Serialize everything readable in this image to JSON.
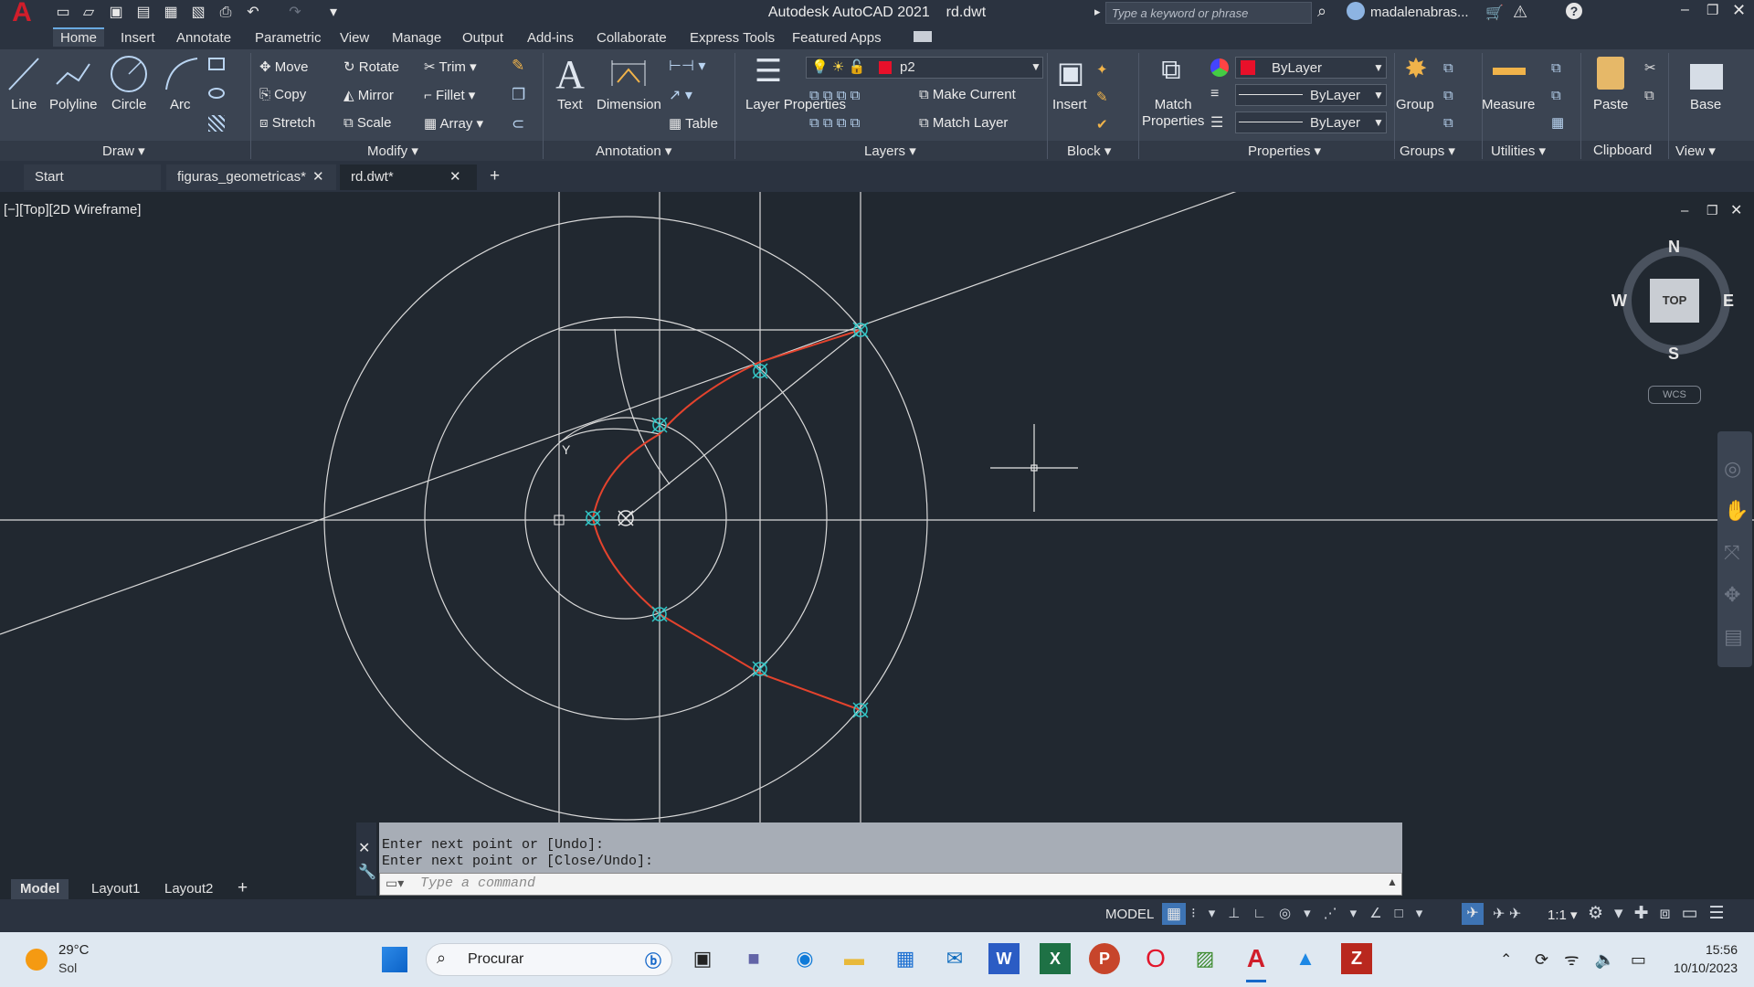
{
  "app": {
    "title": "Autodesk AutoCAD 2021",
    "file": "rd.dwt",
    "logo": "A"
  },
  "search": {
    "placeholder": "Type a keyword or phrase"
  },
  "user": {
    "name": "madalenabras..."
  },
  "ribbon_tabs": [
    "Home",
    "Insert",
    "Annotate",
    "Parametric",
    "View",
    "Manage",
    "Output",
    "Add-ins",
    "Collaborate",
    "Express Tools",
    "Featured Apps"
  ],
  "draw": {
    "line": "Line",
    "polyline": "Polyline",
    "circle": "Circle",
    "arc": "Arc",
    "label": "Draw"
  },
  "modify": {
    "move": "Move",
    "rotate": "Rotate",
    "trim": "Trim",
    "copy": "Copy",
    "mirror": "Mirror",
    "fillet": "Fillet",
    "stretch": "Stretch",
    "scale": "Scale",
    "array": "Array",
    "label": "Modify"
  },
  "annotation": {
    "text": "Text",
    "dimension": "Dimension",
    "table": "Table",
    "label": "Annotation"
  },
  "layers": {
    "layer_properties": "Layer Properties",
    "layer_line2": "Properties",
    "current_layer": "p2",
    "make_current": "Make Current",
    "match_layer": "Match Layer",
    "label": "Layers"
  },
  "block": {
    "insert": "Insert",
    "label": "Block"
  },
  "properties": {
    "match": "Match",
    "match2": "Properties",
    "color": "ByLayer",
    "linetype": "ByLayer",
    "lineweight": "ByLayer",
    "label": "Properties",
    "color_swatch": "#e8102a"
  },
  "groups": {
    "group": "Group",
    "label": "Groups"
  },
  "utilities": {
    "measure": "Measure",
    "label": "Utilities"
  },
  "clipboard": {
    "paste": "Paste",
    "label": "Clipboard"
  },
  "view": {
    "base": "Base",
    "label": "View"
  },
  "file_tabs": [
    "Start",
    "figuras_geometricas*",
    "rd.dwt*"
  ],
  "viewport_label": "[−][Top][2D Wireframe]",
  "viewcube": {
    "n": "N",
    "s": "S",
    "e": "E",
    "w": "W",
    "top": "TOP",
    "wcs": "WCS"
  },
  "ucs_label": "Y",
  "command": {
    "line1": "Enter next point or [Undo]:",
    "line2": "Enter next point or [Close/Undo]:",
    "placeholder": "Type a command"
  },
  "layout_tabs": [
    "Model",
    "Layout1",
    "Layout2"
  ],
  "status": {
    "model": "MODEL",
    "scale": "1:1"
  },
  "weather": {
    "temp": "29°C",
    "desc": "Sol"
  },
  "taskbar": {
    "search": "Procurar",
    "time": "15:56",
    "date": "10/10/2023"
  },
  "colors": {
    "spiral": "#e4432d",
    "markers": "#33c7c7",
    "construction": "#d9d9d9"
  }
}
